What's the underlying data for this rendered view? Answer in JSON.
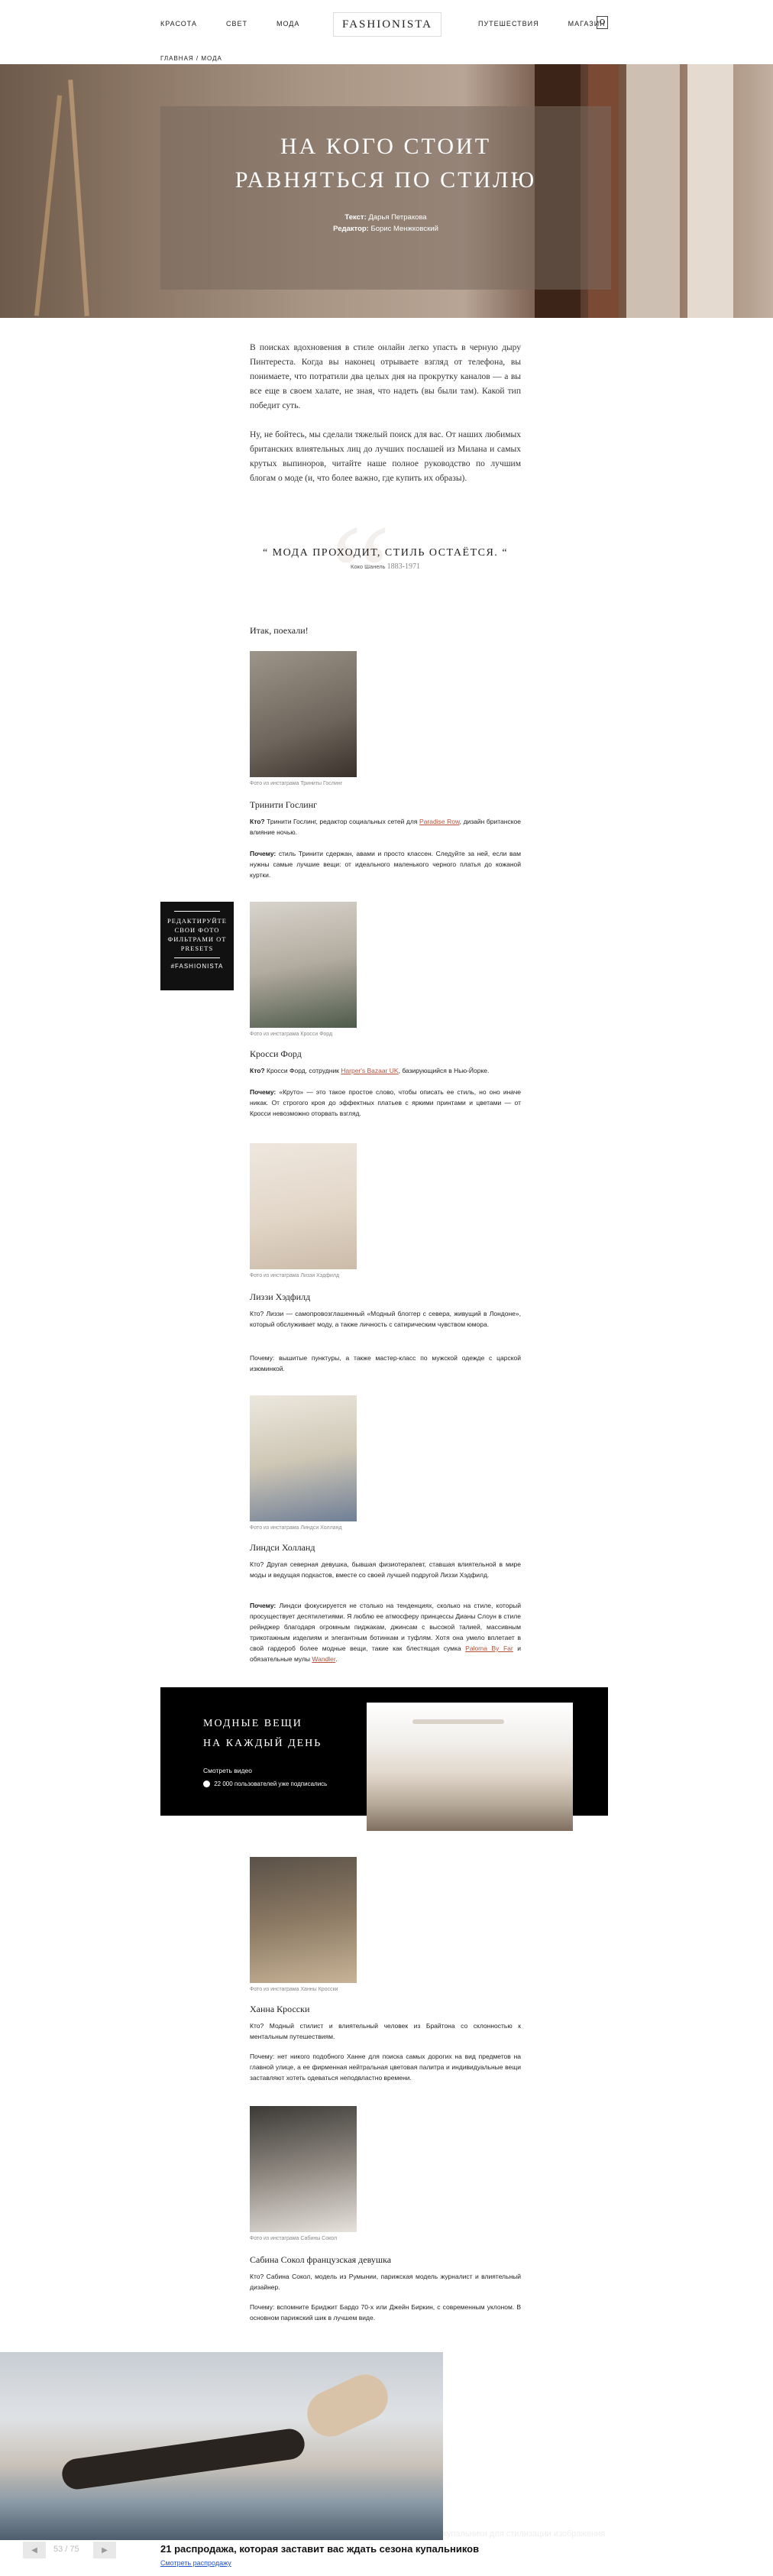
{
  "nav": {
    "left": [
      "КРАСОТА",
      "СВЕТ",
      "МОДА"
    ],
    "logo": "FASHIONISTA",
    "right": [
      "ПУТЕШЕСТВИЯ",
      "МАГАЗИН"
    ],
    "breadcrumb": "ГЛАВНАЯ / МОДА"
  },
  "hero": {
    "title_line1": "НА КОГО СТОИТ",
    "title_line2": "РАВНЯТЬСЯ ПО СТИЛЮ",
    "text_label": "Текст:",
    "text_author": "Дарья Петракова",
    "editor_label": "Редактор:",
    "editor_name": "Борис Менжковский"
  },
  "intro": {
    "p1": "В поисках вдохновения в стиле онлайн легко упасть в черную дыру Пинтереста. Когда вы наконец отрываете взгляд от телефона, вы понимаете, что потратили два целых дня на прокрутку каналов — а вы все еще в своем халате, не зная, что надеть (вы были там). Какой тип победит суть.",
    "p2": "Ну, не бойтесь, мы сделали тяжелый поиск для вас. От наших любимых британских влиятельных лиц до лучших послашей из Милана и самых крутых выпиноров, читайте наше полное руководство по лучшим блогам о моде (и, что более важно, где купить их образы)."
  },
  "quote": {
    "text": "МОДА ПРОХОДИТ, СТИЛЬ ОСТАЁТСЯ.",
    "author": "Коко Шанель",
    "years": "1883-1971"
  },
  "list_intro": "Итак, поехали!",
  "bloggers": [
    {
      "caption": "Фото из инстаграма Триниты Гослинг",
      "name": "Тринити Гослинг",
      "who": "Кто? Тринити Гослинг, редактор социальных сетей для Paradise Row, дизайн британское влияние ночью.",
      "why": "Почему: стиль Тринити сдержан, авами и просто классен. Следуйте за ней, если вам нужны самые лучшие вещи: от идеального маленького черного платья до кожаной куртки."
    },
    {
      "caption": "Фото из инстаграма Кросси Форд",
      "name": "Кросси Форд",
      "who": "Кто? Кросси Форд, сотрудник Harper's Bazaar UK, базирующийся в Нью-Йорке.",
      "why": "Почему: «Круто» — это такое простое слово, чтобы описать ее стиль, но оно иначе никак. От строгого кроя до эффектных платьев с яркими принтами и цветами — от Кросси невозможно оторвать взгляд."
    },
    {
      "caption": "Фото из инстаграма Лиззи Хэдфилд",
      "name": "Лиззи Хэдфилд",
      "who": "Кто? Лиззи — самопровозглашенный «Модный блоггер с севера, живущий в Лондоне», который обслуживает моду, а также личность с сатирическим чувством юмора.",
      "why": "Почему: вышитые пунктуры, а также мастер-класс по мужской одежде с царской изюминкой."
    },
    {
      "caption": "Фото из инстаграма Линдси Холланд",
      "name": "Линдси Холланд",
      "who": "Кто? Другая северная девушка, бывшая физиотерапевт, ставшая влиятельной в мире моды и ведущая подкастов, вместе со своей лучшей подругой Лиззи Хэдфилд.",
      "why": "Почему: Линдси фокусируется не столько на тенденциях, сколько на стиле, который просуществует десятилетиями. Я люблю ее атмосферу принцессы Дианы Слоун в стиле рейнджер благодаря огромным пиджакам, джинсам с высокой талией, массивным трикотажным изделиям и элегантным ботинкам и туфлях. Хотя она умело вплетает в свой гардероб более модные вещи, такие как блестящая сумка Paloma By Far и обязательные мулы Wandler."
    },
    {
      "caption": "Фото из инстаграма Ханны Кросски",
      "name": "Ханна Кросски",
      "who": "Кто? Модный стилист и влиятельный человек из Брайтона со склонностью к ментальным путешествиям.",
      "why": "Почему: нет никого подобного Ханне для поиска самых дорогих на вид предметов на главной улице, а ее фирменная нейтральная цветовая палитра и индивидуальные вещи заставляют хотеть одеваться неподвластно времени."
    },
    {
      "caption": "Фото из инстаграма Сабины Сокол",
      "name": "Сабина Сокол французская девушка",
      "who": "Кто? Сабина Сокол, модель из Румынии, парижская модель журналист и влиятельный дизайнер.",
      "why": "Почему: вспомните Бриджит Бардо 70-х или Джейн Биркин, с современным уклоном. В основном парижский шик в лучшем виде."
    }
  ],
  "presets_badge": [
    "РЕДАКТИРУЙТЕ",
    "СВОИ ФОТО",
    "ФИЛЬТРАМИ ОТ",
    "PRESETS",
    "#FASHIONISTA"
  ],
  "promo": {
    "line1": "МОДНЫЕ ВЕЩИ",
    "line2": "НА КАЖДЫЙ ДЕНЬ",
    "link": "Смотреть видео",
    "subscribers": "22 000 пользователей уже подписались"
  },
  "bottom": {
    "title": "21 распродажа, которая заставит вас ждать сезона купальников",
    "link": "Смотреть распродажу",
    "pager": "53 / 75",
    "overlay": "купальники для стилизации изображения"
  }
}
